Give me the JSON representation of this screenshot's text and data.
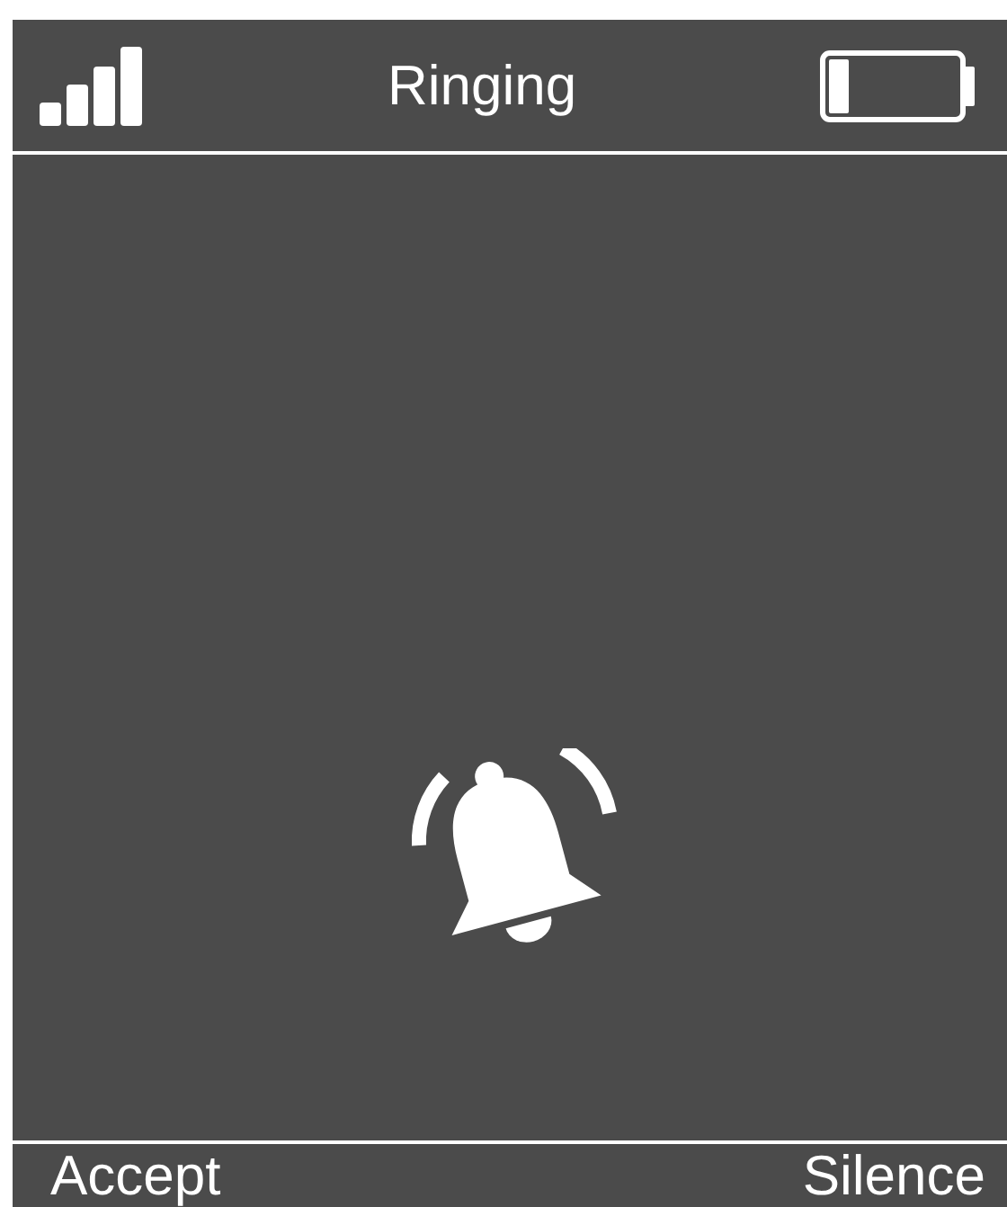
{
  "status_bar": {
    "title": "Ringing"
  },
  "softkeys": [
    {
      "label": "Accept"
    },
    {
      "label": "Silence"
    }
  ]
}
